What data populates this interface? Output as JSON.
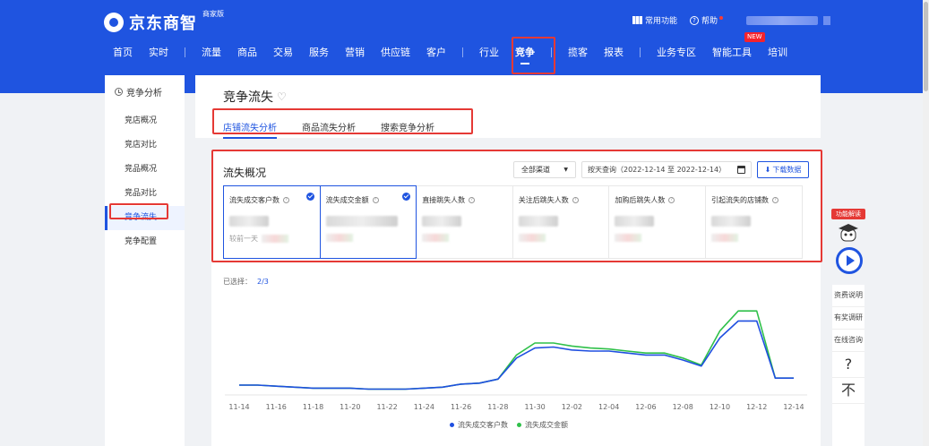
{
  "header": {
    "logo": "京东商智",
    "edition": "商家版",
    "common_functions": "常用功能",
    "help": "帮助"
  },
  "nav": {
    "items": [
      "首页",
      "实时",
      "流量",
      "商品",
      "交易",
      "服务",
      "营销",
      "供应链",
      "客户",
      "行业",
      "竞争",
      "揽客",
      "报表",
      "业务专区",
      "智能工具",
      "培训"
    ],
    "active": "竞争",
    "new_badge": "NEW"
  },
  "sidebar": {
    "header": "竞争分析",
    "items": [
      "竞店概况",
      "竞店对比",
      "竞品概况",
      "竞品对比",
      "竞争流失",
      "竞争配置"
    ],
    "active": "竞争流失"
  },
  "page": {
    "title": "竞争流失",
    "tabs": [
      "店铺流失分析",
      "商品流失分析",
      "搜索竞争分析"
    ]
  },
  "overview": {
    "title": "流失概况",
    "channel": "全部渠道",
    "date_range": "按天查询（2022-12-14 至 2022-12-14）",
    "download": "下载数据",
    "compare_label": "较前一天",
    "metrics": [
      {
        "label": "流失成交客户数",
        "selected": true
      },
      {
        "label": "流失成交金额",
        "selected": true
      },
      {
        "label": "直接跳失人数",
        "selected": false
      },
      {
        "label": "关注后跳失人数",
        "selected": false
      },
      {
        "label": "加购后跳失人数",
        "selected": false
      },
      {
        "label": "引起流失的店铺数",
        "selected": false
      }
    ],
    "selected_text": "已选择：",
    "selected_count": "2/3"
  },
  "chart_data": {
    "type": "line",
    "x": [
      "11-14",
      "11-15",
      "11-16",
      "11-17",
      "11-18",
      "11-19",
      "11-20",
      "11-21",
      "11-22",
      "11-23",
      "11-24",
      "11-25",
      "11-26",
      "11-27",
      "11-28",
      "11-29",
      "11-30",
      "12-01",
      "12-02",
      "12-03",
      "12-04",
      "12-05",
      "12-06",
      "12-07",
      "12-08",
      "12-09",
      "12-10",
      "12-11",
      "12-12",
      "12-13",
      "12-14"
    ],
    "tick_labels": [
      "11-14",
      "11-16",
      "11-18",
      "11-20",
      "11-22",
      "11-24",
      "11-26",
      "11-28",
      "11-30",
      "12-02",
      "12-04",
      "12-06",
      "12-08",
      "12-10",
      "12-12",
      "12-14"
    ],
    "series": [
      {
        "name": "流失成交客户数",
        "color": "#1f4fe0",
        "values": [
          0.08,
          0.08,
          0.07,
          0.06,
          0.05,
          0.05,
          0.05,
          0.04,
          0.04,
          0.04,
          0.05,
          0.06,
          0.09,
          0.1,
          0.14,
          0.35,
          0.45,
          0.46,
          0.43,
          0.42,
          0.42,
          0.4,
          0.38,
          0.38,
          0.33,
          0.27,
          0.55,
          0.72,
          0.72,
          0.15,
          0.15
        ]
      },
      {
        "name": "流失成交金额",
        "color": "#2fc04a",
        "values": [
          0.08,
          0.08,
          0.07,
          0.06,
          0.05,
          0.05,
          0.05,
          0.04,
          0.04,
          0.04,
          0.05,
          0.06,
          0.09,
          0.1,
          0.14,
          0.38,
          0.5,
          0.5,
          0.47,
          0.45,
          0.44,
          0.42,
          0.4,
          0.4,
          0.35,
          0.28,
          0.62,
          0.82,
          0.82,
          0.15,
          0.15
        ]
      }
    ]
  },
  "float": {
    "tag": "功能解读",
    "buttons": [
      "资费说明",
      "有奖调研",
      "在线咨询",
      "?",
      "不"
    ]
  }
}
